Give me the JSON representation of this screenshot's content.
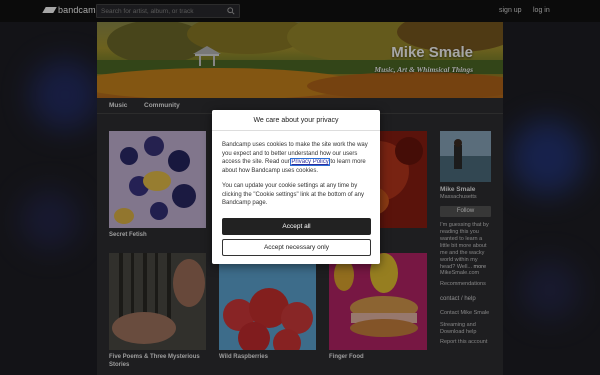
{
  "topbar": {
    "logo_text": "bandcamp",
    "search_placeholder": "Search for artist, album, or track",
    "signup_label": "sign up",
    "login_label": "log in"
  },
  "banner": {
    "title": "Mike Smale",
    "subtitle": "Music, Art & Whimsical Things"
  },
  "nav": {
    "music": "Music",
    "community": "Community"
  },
  "albums": [
    {
      "title": "Secret Fetish"
    },
    {
      "title": "Five Poems & Three Mysterious Stories"
    },
    {
      "title": "Wild Raspberries"
    },
    {
      "title": "Finger Food"
    }
  ],
  "artist": {
    "name": "Mike Smale",
    "location": "Massachusetts",
    "follow_label": "Follow",
    "bio": "I'm guessing that by reading this you wanted to learn a little bit more about me and the wacky world within my head? Well...",
    "more_label": "more",
    "website": "MikeSmale.com",
    "recommendations": "Recommendations",
    "help_heading": "contact / help",
    "contact": "Contact Mike Smale",
    "streaming": "Streaming and Download help",
    "report": "Report this account"
  },
  "modal": {
    "heading": "We care about your privacy",
    "p1_before": "Bandcamp uses cookies to make the site work the way you expect and to better understand how our users access the site. Read our",
    "privacy_link": "Privacy Policy",
    "p1_after": "to learn more about how Bandcamp uses cookies.",
    "p2": "You can update your cookie settings at any time by clicking the \"Cookie settings\" link at the bottom of any Bandcamp page.",
    "accept_all": "Accept all",
    "accept_necessary": "Accept necessary only"
  },
  "colors": {
    "topbar": "#111111",
    "page_bg": "#2e2e32",
    "button_dark": "#222222",
    "link_focus": "#2b6fd6"
  }
}
